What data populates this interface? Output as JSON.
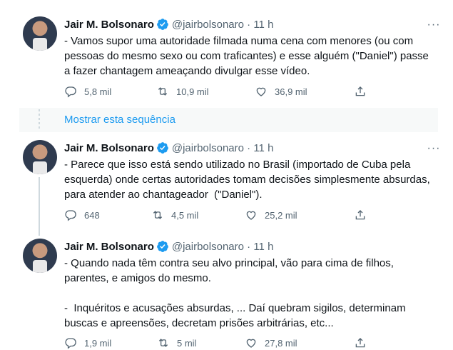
{
  "tweets": [
    {
      "name": "Jair M. Bolsonaro",
      "handle": "@jairbolsonaro",
      "separator": "·",
      "time": "11 h",
      "more": "···",
      "text": "- Vamos supor uma autoridade filmada numa cena com menores (ou com\npessoas do mesmo sexo ou com traficantes) e esse alguém (\"Daniel\") passe\na fazer chantagem ameaçando divulgar esse vídeo.",
      "replies": "5,8 mil",
      "retweets": "10,9 mil",
      "likes": "36,9 mil"
    },
    {
      "name": "Jair M. Bolsonaro",
      "handle": "@jairbolsonaro",
      "separator": "·",
      "time": "11 h",
      "more": "···",
      "text": "- Parece que isso está sendo utilizado no Brasil (importado de Cuba pela\nesquerda) onde certas autoridades tomam decisões simplesmente absurdas,\npara atender ao chantageador  (\"Daniel\").",
      "replies": "648",
      "retweets": "4,5 mil",
      "likes": "25,2 mil"
    },
    {
      "name": "Jair M. Bolsonaro",
      "handle": "@jairbolsonaro",
      "separator": "·",
      "time": "11 h",
      "more": "···",
      "text": "- Quando nada têm contra seu alvo principal, vão para cima de filhos,\nparentes, e amigos do mesmo.\n\n-  Inquéritos e acusações absurdas, ... Daí quebram sigilos, determinam\nbuscas e apreensões, decretam prisões arbitrárias, etc...",
      "replies": "1,9 mil",
      "retweets": "5 mil",
      "likes": "27,8 mil"
    }
  ],
  "show_thread_label": "Mostrar esta sequência",
  "colors": {
    "accent": "#1d9bf0",
    "muted": "#536471",
    "text": "#0f1419"
  }
}
